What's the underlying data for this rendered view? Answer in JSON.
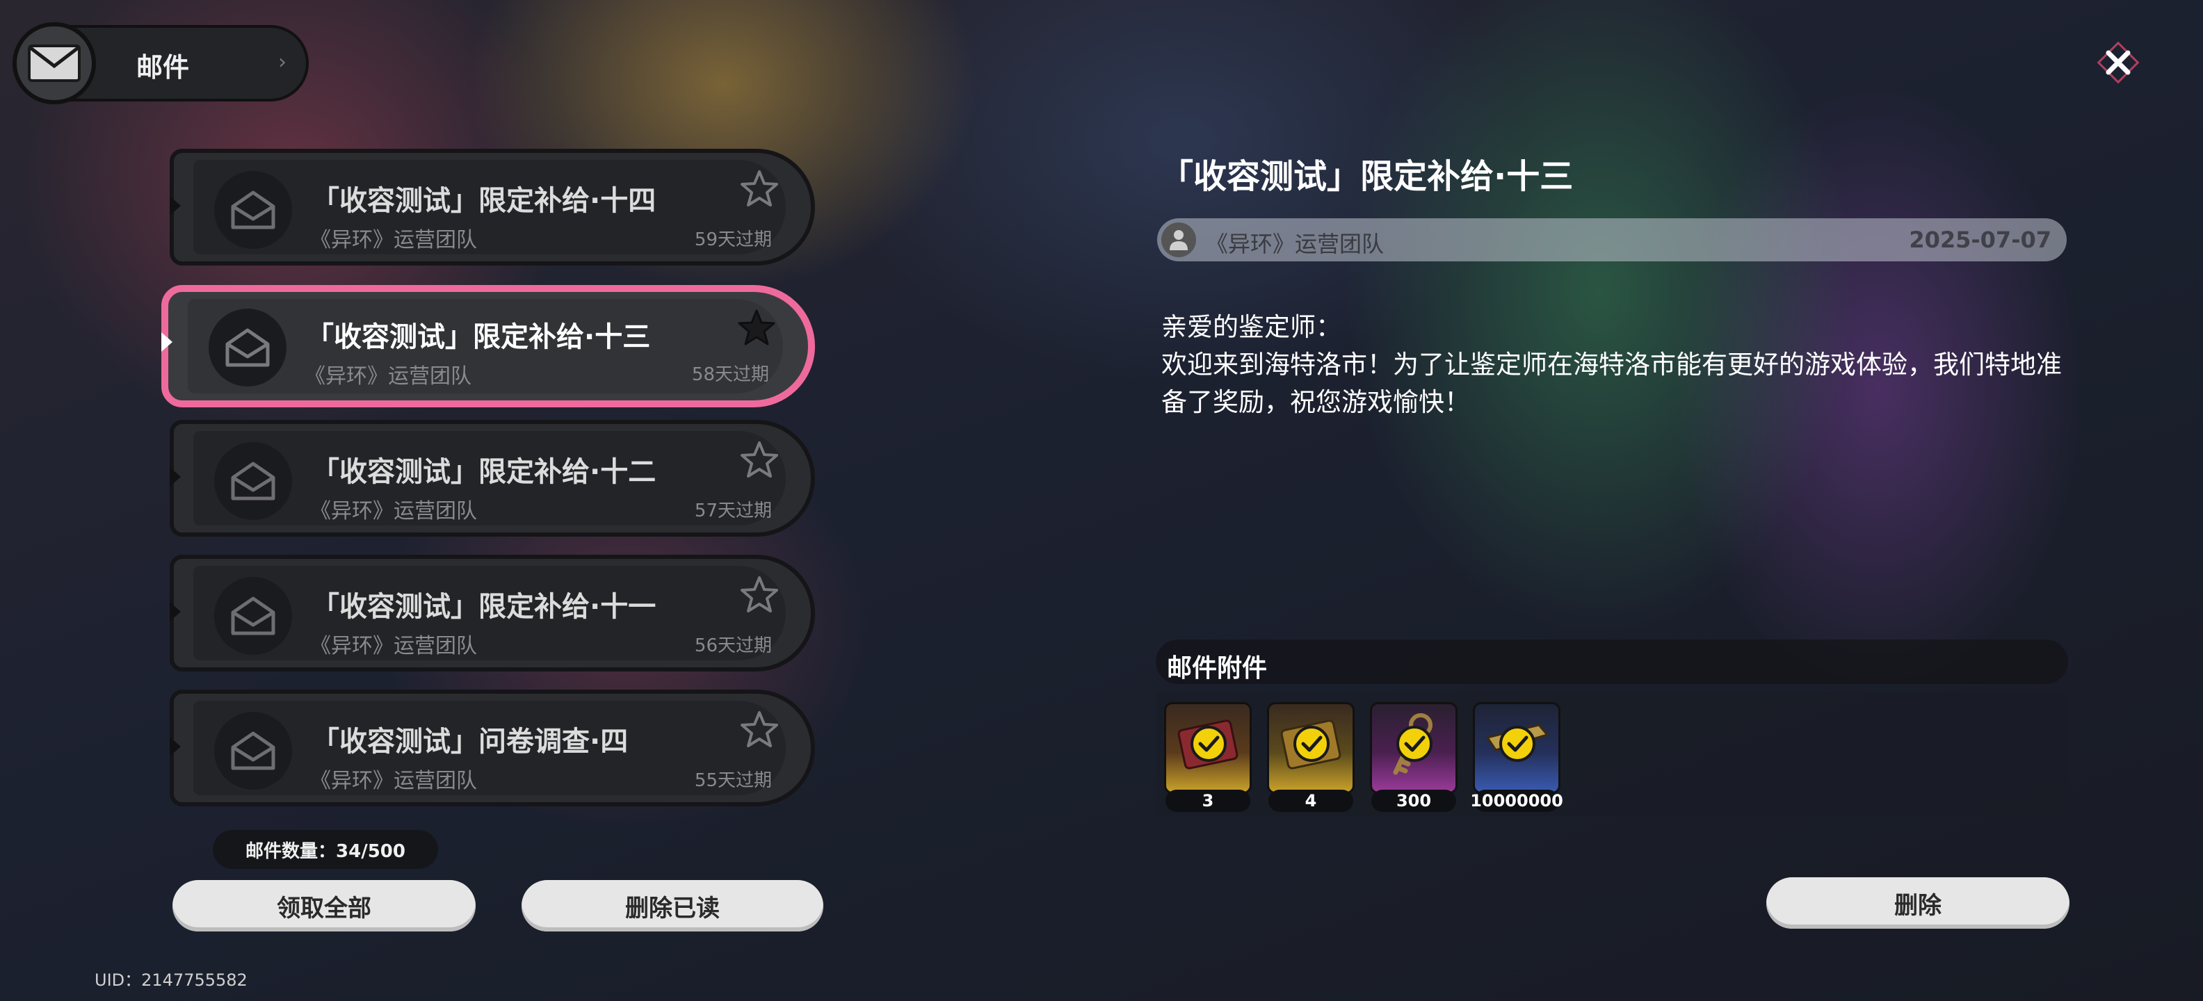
{
  "header": {
    "title": "邮件"
  },
  "mail_list": [
    {
      "title": "「收容测试」限定补给·十四",
      "sender": "《异环》运营团队",
      "expire": "59天过期",
      "selected": false
    },
    {
      "title": "「收容测试」限定补给·十三",
      "sender": "《异环》运营团队",
      "expire": "58天过期",
      "selected": true
    },
    {
      "title": "「收容测试」限定补给·十二",
      "sender": "《异环》运营团队",
      "expire": "57天过期",
      "selected": false
    },
    {
      "title": "「收容测试」限定补给·十一",
      "sender": "《异环》运营团队",
      "expire": "56天过期",
      "selected": false
    },
    {
      "title": "「收容测试」问卷调查·四",
      "sender": "《异环》运营团队",
      "expire": "55天过期",
      "selected": false
    }
  ],
  "footer": {
    "mail_count": "邮件数量：34/500",
    "claim_all_label": "领取全部",
    "delete_read_label": "删除已读",
    "uid": "UID：2147755582"
  },
  "detail": {
    "title": "「收容测试」限定补给·十三",
    "sender": "《异环》运营团队",
    "date": "2025-07-07",
    "greeting": "亲爱的鉴定师：",
    "body": "欢迎来到海特洛市！为了让鉴定师在海特洛市能有更好的游戏体验，我们特地准备了奖励，祝您游戏愉快！",
    "attachments_label": "邮件附件",
    "attachments": [
      {
        "icon": "red-box-icon",
        "qty": "3",
        "color": "#c9a12a"
      },
      {
        "icon": "gold-box-icon",
        "qty": "4",
        "color": "#c9a12a"
      },
      {
        "icon": "key-icon",
        "qty": "300",
        "color": "#8a2c8a"
      },
      {
        "icon": "gold-bar-icon",
        "qty": "10000000",
        "color": "#2c4a9a"
      }
    ],
    "delete_label": "删除"
  },
  "colors": {
    "selected_border": "#ef6a9c",
    "check_yellow": "#f2d10a"
  }
}
